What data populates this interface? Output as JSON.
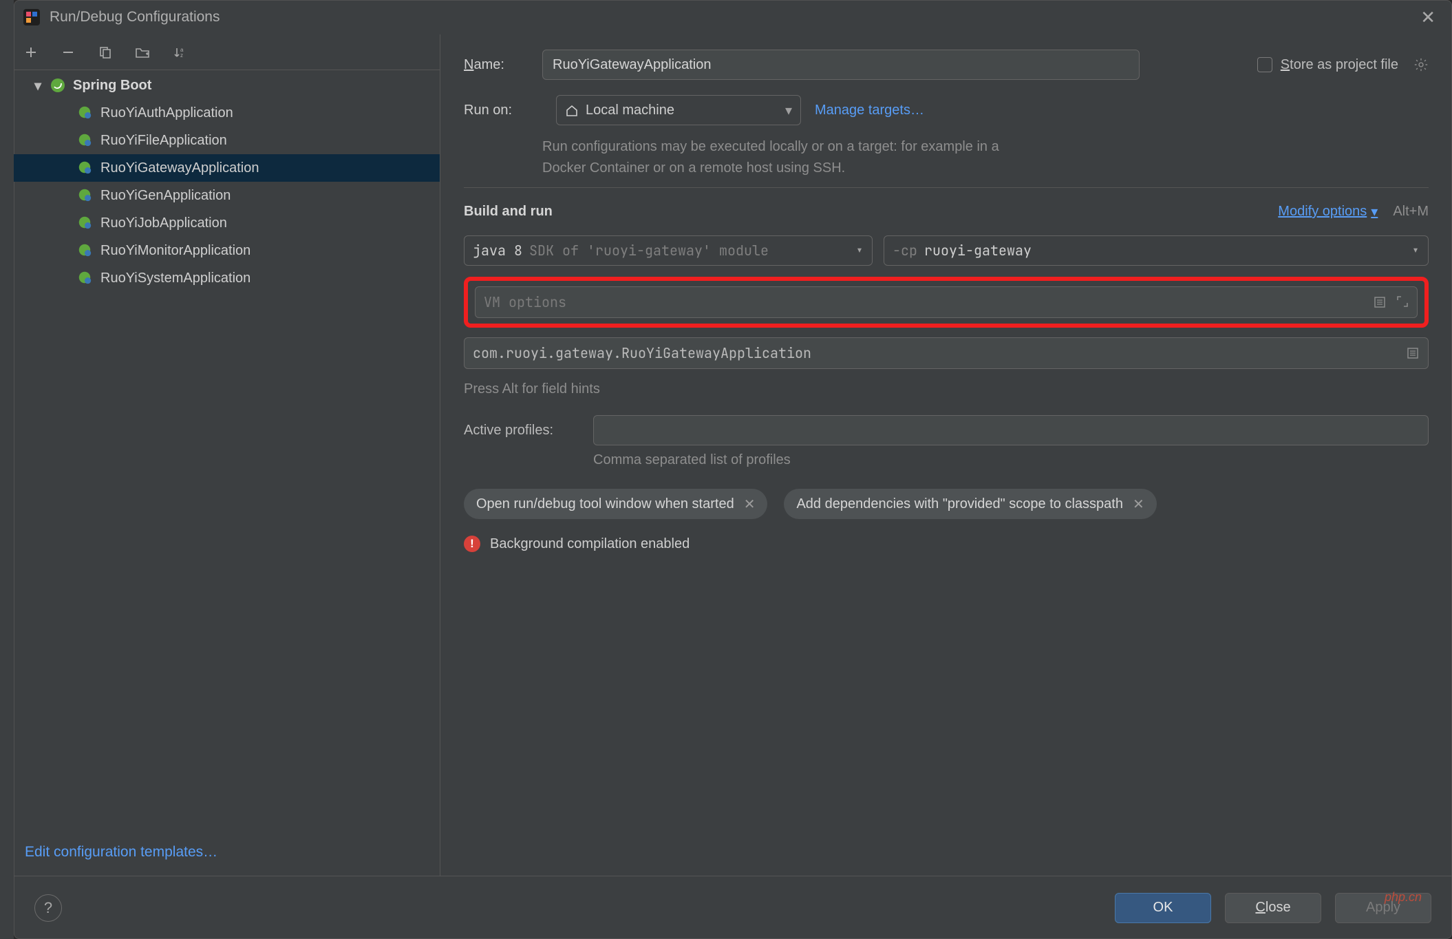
{
  "window": {
    "title": "Run/Debug Configurations"
  },
  "sidebar": {
    "root": {
      "label": "Spring Boot"
    },
    "items": [
      {
        "label": "RuoYiAuthApplication"
      },
      {
        "label": "RuoYiFileApplication"
      },
      {
        "label": "RuoYiGatewayApplication",
        "selected": true
      },
      {
        "label": "RuoYiGenApplication"
      },
      {
        "label": "RuoYiJobApplication"
      },
      {
        "label": "RuoYiMonitorApplication"
      },
      {
        "label": "RuoYiSystemApplication"
      }
    ],
    "edit_templates": "Edit configuration templates…"
  },
  "form": {
    "name_label": "Name:",
    "name_value": "RuoYiGatewayApplication",
    "store_label": "Store as project file",
    "runon_label": "Run on:",
    "runon_value": "Local machine",
    "manage_targets": "Manage targets…",
    "runon_hint": "Run configurations may be executed locally or on a target: for example in a Docker Container or on a remote host using SSH.",
    "section_build": "Build and run",
    "modify_options": "Modify options",
    "modify_shortcut": "Alt+M",
    "sdk_prefix": "java 8",
    "sdk_suffix": " SDK of 'ruoyi-gateway' module",
    "cp_prefix": "-cp ",
    "cp_value": "ruoyi-gateway",
    "vm_placeholder": "VM options",
    "main_class": "com.ruoyi.gateway.RuoYiGatewayApplication",
    "field_hint": "Press Alt for field hints",
    "profiles_label": "Active profiles:",
    "profiles_value": "",
    "profiles_hint": "Comma separated list of profiles",
    "chip1": "Open run/debug tool window when started",
    "chip2": "Add dependencies with \"provided\" scope to classpath",
    "warn": "Background compilation enabled"
  },
  "buttons": {
    "ok": "OK",
    "close": "Close",
    "apply": "Apply"
  },
  "watermark": "php.cn"
}
